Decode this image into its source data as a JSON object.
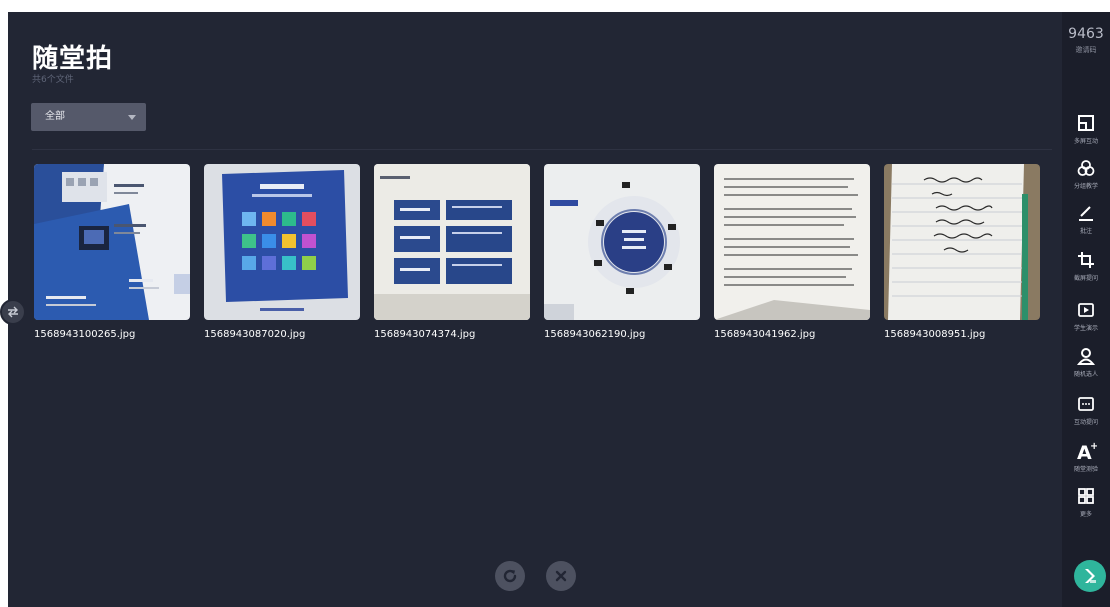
{
  "page": {
    "title": "随堂拍",
    "file_count": "共6个文件",
    "filter": {
      "selected": "全部"
    }
  },
  "photos": [
    {
      "filename": "1568943100265.jpg"
    },
    {
      "filename": "1568943087020.jpg"
    },
    {
      "filename": "1568943074374.jpg"
    },
    {
      "filename": "1568943062190.jpg"
    },
    {
      "filename": "1568943041962.jpg"
    },
    {
      "filename": "1568943008951.jpg"
    }
  ],
  "controls": {
    "refresh_icon": "refresh-icon",
    "close_icon": "close-icon",
    "swap_icon": "swap-arrows-icon"
  },
  "sidebar": {
    "invite_code": "9463",
    "invite_label": "邀请码",
    "tools": [
      {
        "label": "多屏互动",
        "icon": "multi-screen-icon"
      },
      {
        "label": "分组教学",
        "icon": "group-icon"
      },
      {
        "label": "批注",
        "icon": "pen-icon"
      },
      {
        "label": "截屏提问",
        "icon": "crop-icon"
      },
      {
        "label": "学生演示",
        "icon": "play-icon"
      },
      {
        "label": "随机选人",
        "icon": "person-icon"
      },
      {
        "label": "互动提问",
        "icon": "chat-icon"
      },
      {
        "label": "随堂测验",
        "icon": "font-plus-icon"
      },
      {
        "label": "更多",
        "icon": "grid-icon"
      }
    ],
    "assistant_icon": "assistant-icon"
  },
  "colors": {
    "background": "#222634",
    "sidebar": "#1b1e2a",
    "accent": "#2fb59c"
  }
}
